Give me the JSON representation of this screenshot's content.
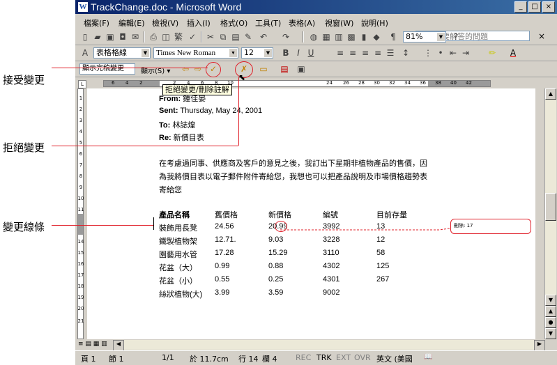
{
  "window": {
    "title": "TrackChange.doc - Microsoft Word",
    "app_icon": "W",
    "buttons": [
      "_",
      "□",
      "×"
    ]
  },
  "menu": {
    "items": [
      "檔案(F)",
      "編輯(E)",
      "檢視(V)",
      "插入(I)",
      "格式(O)",
      "工具(T)",
      "表格(A)",
      "視窗(W)",
      "說明(H)"
    ],
    "help_placeholder": "輸入需要解答的問題",
    "close": "×"
  },
  "standard_toolbar": {
    "zoom": "81%",
    "help_icon": "?"
  },
  "formatting_toolbar": {
    "style": "表格格線",
    "font": "Times New Roman",
    "size": "12"
  },
  "reviewing_toolbar": {
    "display_mode": "顯示完稿變更",
    "show_menu": "顯示(S) ▾",
    "tooltip": "拒絕變更/刪除註解"
  },
  "ruler": {
    "ticks": [
      "6",
      "4",
      "2",
      "",
      "2",
      "4",
      "6",
      "8",
      "10",
      "12",
      "14",
      "16",
      "18",
      "20",
      "22",
      "24",
      "26",
      "28",
      "30",
      "32",
      "34",
      "36",
      "38",
      "40",
      "42"
    ]
  },
  "vertical_ruler": {
    "numbers": [
      "1",
      "2",
      "3",
      "4",
      "5",
      "6",
      "7",
      "8",
      "9",
      "10",
      "11",
      "12",
      "13",
      "14",
      "15",
      "16",
      "17",
      "18",
      "19",
      "20",
      "21"
    ]
  },
  "email_header": {
    "from_label": "From:",
    "from_value": "鍾佳晏",
    "sent_label": "Sent:",
    "sent_value": "Thursday, May 24, 2001",
    "to_label": "To:",
    "to_value": "林誌煌",
    "re_label": "Re:",
    "re_value": "新價目表"
  },
  "body_text": [
    "在考慮過同事、供應商及客戶的意見之後，我訂出下星期非植物產品的售價，因",
    "為我將價目表以電子郵件附件寄給您，我想也可以把產品說明及市場價格趨勢表",
    "寄給您"
  ],
  "table": {
    "headers": [
      "產品名稱",
      "舊價格",
      "新價格",
      "編號",
      "目前存量"
    ],
    "rows": [
      [
        "裝飾用長凳",
        "24.56",
        "20.99",
        "3992",
        "13"
      ],
      [
        "鐵製植物架",
        "12.71.",
        "9.03",
        "3228",
        "12"
      ],
      [
        "園藝用水管",
        "17.28",
        "15.29",
        "3110",
        "58"
      ],
      [
        "花盆（大）",
        "0.99",
        "0.88",
        "4302",
        "125"
      ],
      [
        "花盆（小）",
        "0.55",
        "0.25",
        "4301",
        "267"
      ],
      [
        "絲狀植物(大)",
        "3.99",
        "3.59",
        "9002",
        ""
      ]
    ]
  },
  "balloon": {
    "text": "刪除: 17"
  },
  "status_bar": {
    "page": "頁 1",
    "section": "節 1",
    "pages": "1/1",
    "position": "於 11.7cm",
    "line": "行 14",
    "column": "欄 4",
    "rec": "REC",
    "trk": "TRK",
    "ext": "EXT",
    "ovr": "OVR",
    "language": "英文 (美國"
  },
  "callouts": {
    "accept": "接受變更",
    "reject": "拒絕變更",
    "change_line": "變更線條"
  },
  "colors": {
    "highlight": "#e0202a",
    "titlebar": "#0a246a",
    "chrome": "#d4d0c8"
  }
}
